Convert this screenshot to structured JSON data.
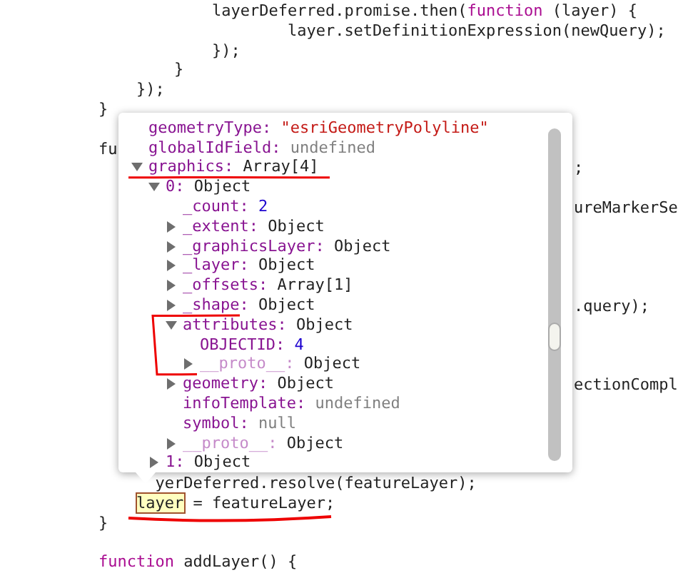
{
  "code_lines": [
    {
      "kind": "code",
      "segments": [
        {
          "text": "            layerDeferred.promise.then(",
          "kind": "plain"
        },
        {
          "text": "function",
          "kind": "keyword"
        },
        {
          "text": " (layer) {",
          "kind": "plain"
        }
      ]
    },
    {
      "kind": "code",
      "segments": [
        {
          "text": "                    layer.setDefinitionExpression(newQuery);",
          "kind": "plain"
        }
      ]
    },
    {
      "kind": "code",
      "segments": [
        {
          "text": "            });",
          "kind": "plain"
        }
      ]
    },
    {
      "kind": "code",
      "segments": [
        {
          "text": "        }",
          "kind": "plain"
        }
      ]
    },
    {
      "kind": "code",
      "segments": [
        {
          "text": "    });",
          "kind": "plain"
        }
      ]
    },
    {
      "kind": "code",
      "segments": [
        {
          "text": "}",
          "kind": "plain"
        }
      ]
    },
    {
      "kind": "covered"
    },
    {
      "kind": "code",
      "segments": [
        {
          "text": "fu",
          "kind": "plain"
        }
      ]
    },
    {
      "kind": "covered",
      "tail": ";"
    },
    {
      "kind": "covered"
    },
    {
      "kind": "covered",
      "tail": "ureMarkerSe"
    },
    {
      "kind": "covered"
    },
    {
      "kind": "covered"
    },
    {
      "kind": "covered"
    },
    {
      "kind": "covered"
    },
    {
      "kind": "covered",
      "tail": ".query);"
    },
    {
      "kind": "covered"
    },
    {
      "kind": "covered"
    },
    {
      "kind": "covered"
    },
    {
      "kind": "covered",
      "tail": "ectionCompl"
    },
    {
      "kind": "covered"
    },
    {
      "kind": "covered"
    },
    {
      "kind": "covered"
    },
    {
      "kind": "covered"
    },
    {
      "kind": "code",
      "segments": [
        {
          "text": "      yerDeferred.resolve(featureLayer);",
          "kind": "plain"
        }
      ]
    },
    {
      "kind": "code",
      "segments": [
        {
          "text": "    layer",
          "kind": "highlight"
        },
        {
          "text": " = featureLayer;",
          "kind": "plain"
        }
      ]
    },
    {
      "kind": "code",
      "segments": [
        {
          "text": "}",
          "kind": "plain"
        }
      ]
    },
    {
      "kind": "covered"
    },
    {
      "kind": "code",
      "segments": [
        {
          "text": "function",
          "kind": "keyword"
        },
        {
          "text": " addLayer() {",
          "kind": "plain"
        }
      ]
    }
  ],
  "inspector_popup": {
    "properties": [
      {
        "key": "geometryType:",
        "value": "\"esriGeometryPolyline\"",
        "color": "#c41a16",
        "dimmed": false
      },
      {
        "key": "globalIdField:",
        "value": "undefined",
        "color": "#808080",
        "dimmed": false
      },
      {
        "key": "graphics:",
        "value": "Array[4]",
        "color": "#222222",
        "dimmed": false,
        "expanded": true,
        "children": [
          {
            "key": "0:",
            "value": "Object",
            "color": "#222222",
            "dimmed": false,
            "expanded": true,
            "children": [
              {
                "key": "_count:",
                "value": "2",
                "color": "#1c00cf",
                "dimmed": false
              },
              {
                "key": "_extent:",
                "value": "Object",
                "color": "#222222",
                "dimmed": false,
                "expanded": false
              },
              {
                "key": "_graphicsLayer:",
                "value": "Object",
                "color": "#222222",
                "dimmed": false,
                "expanded": false
              },
              {
                "key": "_layer:",
                "value": "Object",
                "color": "#222222",
                "dimmed": false,
                "expanded": false
              },
              {
                "key": "_offsets:",
                "value": "Array[1]",
                "color": "#222222",
                "dimmed": false,
                "expanded": false
              },
              {
                "key": "_shape:",
                "value": "Object",
                "color": "#222222",
                "dimmed": false,
                "expanded": false
              },
              {
                "key": "attributes:",
                "value": "Object",
                "color": "#222222",
                "dimmed": false,
                "expanded": true,
                "children": [
                  {
                    "key": "OBJECTID:",
                    "value": "4",
                    "color": "#1c00cf",
                    "dimmed": false
                  },
                  {
                    "key": "__proto__:",
                    "value": "Object",
                    "color": "#222222",
                    "dimmed": true,
                    "expanded": false
                  }
                ]
              },
              {
                "key": "geometry:",
                "value": "Object",
                "color": "#222222",
                "dimmed": false,
                "expanded": false
              },
              {
                "key": "infoTemplate:",
                "value": "undefined",
                "color": "#808080",
                "dimmed": false
              },
              {
                "key": "symbol:",
                "value": "null",
                "color": "#808080",
                "dimmed": false
              },
              {
                "key": "__proto__:",
                "value": "Object",
                "color": "#222222",
                "dimmed": true,
                "expanded": false
              }
            ]
          },
          {
            "key": "1:",
            "value": "Object",
            "color": "#222222",
            "dimmed": false,
            "expanded": false
          }
        ]
      }
    ]
  }
}
